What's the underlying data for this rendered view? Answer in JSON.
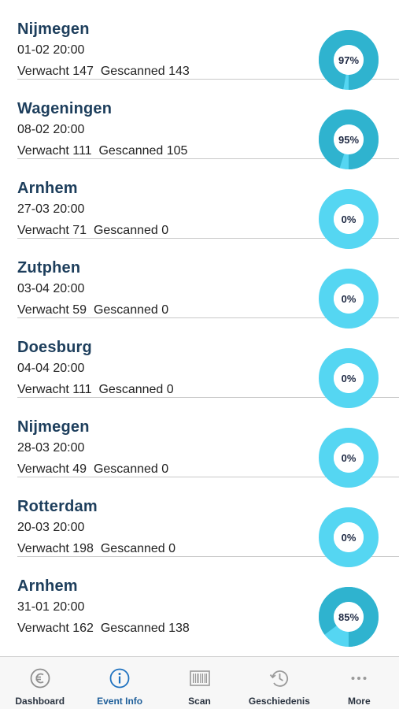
{
  "events": [
    {
      "title": "Nijmegen",
      "datetime": "01-02 20:00",
      "expected_label": "Verwacht 147",
      "scanned_label": "Gescanned 143",
      "percent_label": "97%",
      "progress": 0.97
    },
    {
      "title": "Wageningen",
      "datetime": "08-02 20:00",
      "expected_label": "Verwacht 111",
      "scanned_label": "Gescanned 105",
      "percent_label": "95%",
      "progress": 0.95
    },
    {
      "title": "Arnhem",
      "datetime": "27-03 20:00",
      "expected_label": "Verwacht 71",
      "scanned_label": "Gescanned 0",
      "percent_label": "0%",
      "progress": 0
    },
    {
      "title": "Zutphen",
      "datetime": "03-04 20:00",
      "expected_label": "Verwacht 59",
      "scanned_label": "Gescanned 0",
      "percent_label": "0%",
      "progress": 0
    },
    {
      "title": "Doesburg",
      "datetime": "04-04 20:00",
      "expected_label": "Verwacht 111",
      "scanned_label": "Gescanned 0",
      "percent_label": "0%",
      "progress": 0
    },
    {
      "title": "Nijmegen",
      "datetime": "28-03 20:00",
      "expected_label": "Verwacht 49",
      "scanned_label": "Gescanned 0",
      "percent_label": "0%",
      "progress": 0
    },
    {
      "title": "Rotterdam",
      "datetime": "20-03 20:00",
      "expected_label": "Verwacht 198",
      "scanned_label": "Gescanned 0",
      "percent_label": "0%",
      "progress": 0
    },
    {
      "title": "Arnhem",
      "datetime": "31-01 20:00",
      "expected_label": "Verwacht 162",
      "scanned_label": "Gescanned 138",
      "percent_label": "85%",
      "progress": 0.85
    }
  ],
  "tab_bar": {
    "items": [
      {
        "label": "Dashboard",
        "icon": "euro-icon",
        "active": false
      },
      {
        "label": "Event Info",
        "icon": "info-icon",
        "active": true
      },
      {
        "label": "Scan",
        "icon": "barcode-icon",
        "active": false
      },
      {
        "label": "Geschiedenis",
        "icon": "history-icon",
        "active": false
      },
      {
        "label": "More",
        "icon": "more-icon",
        "active": false
      }
    ]
  },
  "colors": {
    "done": "#2fb3cf",
    "remaining": "#55d6f2",
    "title": "#1d3e5c",
    "active_tab": "#1f5f9a",
    "inactive_tab_icon": "#9a9a9a"
  }
}
